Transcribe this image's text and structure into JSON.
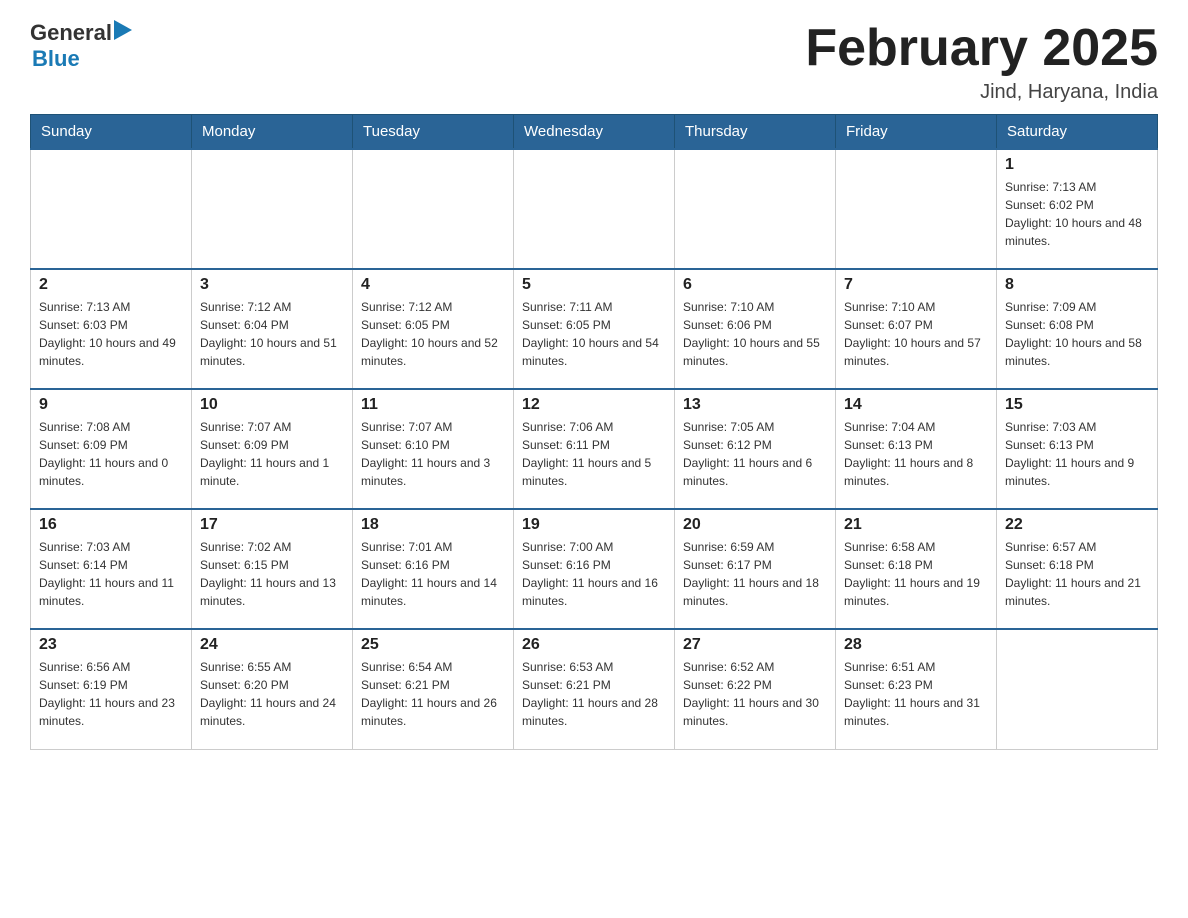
{
  "header": {
    "logo": {
      "general": "General",
      "arrow": "▶",
      "blue": "Blue"
    },
    "title": "February 2025",
    "location": "Jind, Haryana, India"
  },
  "days_of_week": [
    "Sunday",
    "Monday",
    "Tuesday",
    "Wednesday",
    "Thursday",
    "Friday",
    "Saturday"
  ],
  "weeks": [
    [
      {
        "day": "",
        "sunrise": "",
        "sunset": "",
        "daylight": ""
      },
      {
        "day": "",
        "sunrise": "",
        "sunset": "",
        "daylight": ""
      },
      {
        "day": "",
        "sunrise": "",
        "sunset": "",
        "daylight": ""
      },
      {
        "day": "",
        "sunrise": "",
        "sunset": "",
        "daylight": ""
      },
      {
        "day": "",
        "sunrise": "",
        "sunset": "",
        "daylight": ""
      },
      {
        "day": "",
        "sunrise": "",
        "sunset": "",
        "daylight": ""
      },
      {
        "day": "1",
        "sunrise": "Sunrise: 7:13 AM",
        "sunset": "Sunset: 6:02 PM",
        "daylight": "Daylight: 10 hours and 48 minutes."
      }
    ],
    [
      {
        "day": "2",
        "sunrise": "Sunrise: 7:13 AM",
        "sunset": "Sunset: 6:03 PM",
        "daylight": "Daylight: 10 hours and 49 minutes."
      },
      {
        "day": "3",
        "sunrise": "Sunrise: 7:12 AM",
        "sunset": "Sunset: 6:04 PM",
        "daylight": "Daylight: 10 hours and 51 minutes."
      },
      {
        "day": "4",
        "sunrise": "Sunrise: 7:12 AM",
        "sunset": "Sunset: 6:05 PM",
        "daylight": "Daylight: 10 hours and 52 minutes."
      },
      {
        "day": "5",
        "sunrise": "Sunrise: 7:11 AM",
        "sunset": "Sunset: 6:05 PM",
        "daylight": "Daylight: 10 hours and 54 minutes."
      },
      {
        "day": "6",
        "sunrise": "Sunrise: 7:10 AM",
        "sunset": "Sunset: 6:06 PM",
        "daylight": "Daylight: 10 hours and 55 minutes."
      },
      {
        "day": "7",
        "sunrise": "Sunrise: 7:10 AM",
        "sunset": "Sunset: 6:07 PM",
        "daylight": "Daylight: 10 hours and 57 minutes."
      },
      {
        "day": "8",
        "sunrise": "Sunrise: 7:09 AM",
        "sunset": "Sunset: 6:08 PM",
        "daylight": "Daylight: 10 hours and 58 minutes."
      }
    ],
    [
      {
        "day": "9",
        "sunrise": "Sunrise: 7:08 AM",
        "sunset": "Sunset: 6:09 PM",
        "daylight": "Daylight: 11 hours and 0 minutes."
      },
      {
        "day": "10",
        "sunrise": "Sunrise: 7:07 AM",
        "sunset": "Sunset: 6:09 PM",
        "daylight": "Daylight: 11 hours and 1 minute."
      },
      {
        "day": "11",
        "sunrise": "Sunrise: 7:07 AM",
        "sunset": "Sunset: 6:10 PM",
        "daylight": "Daylight: 11 hours and 3 minutes."
      },
      {
        "day": "12",
        "sunrise": "Sunrise: 7:06 AM",
        "sunset": "Sunset: 6:11 PM",
        "daylight": "Daylight: 11 hours and 5 minutes."
      },
      {
        "day": "13",
        "sunrise": "Sunrise: 7:05 AM",
        "sunset": "Sunset: 6:12 PM",
        "daylight": "Daylight: 11 hours and 6 minutes."
      },
      {
        "day": "14",
        "sunrise": "Sunrise: 7:04 AM",
        "sunset": "Sunset: 6:13 PM",
        "daylight": "Daylight: 11 hours and 8 minutes."
      },
      {
        "day": "15",
        "sunrise": "Sunrise: 7:03 AM",
        "sunset": "Sunset: 6:13 PM",
        "daylight": "Daylight: 11 hours and 9 minutes."
      }
    ],
    [
      {
        "day": "16",
        "sunrise": "Sunrise: 7:03 AM",
        "sunset": "Sunset: 6:14 PM",
        "daylight": "Daylight: 11 hours and 11 minutes."
      },
      {
        "day": "17",
        "sunrise": "Sunrise: 7:02 AM",
        "sunset": "Sunset: 6:15 PM",
        "daylight": "Daylight: 11 hours and 13 minutes."
      },
      {
        "day": "18",
        "sunrise": "Sunrise: 7:01 AM",
        "sunset": "Sunset: 6:16 PM",
        "daylight": "Daylight: 11 hours and 14 minutes."
      },
      {
        "day": "19",
        "sunrise": "Sunrise: 7:00 AM",
        "sunset": "Sunset: 6:16 PM",
        "daylight": "Daylight: 11 hours and 16 minutes."
      },
      {
        "day": "20",
        "sunrise": "Sunrise: 6:59 AM",
        "sunset": "Sunset: 6:17 PM",
        "daylight": "Daylight: 11 hours and 18 minutes."
      },
      {
        "day": "21",
        "sunrise": "Sunrise: 6:58 AM",
        "sunset": "Sunset: 6:18 PM",
        "daylight": "Daylight: 11 hours and 19 minutes."
      },
      {
        "day": "22",
        "sunrise": "Sunrise: 6:57 AM",
        "sunset": "Sunset: 6:18 PM",
        "daylight": "Daylight: 11 hours and 21 minutes."
      }
    ],
    [
      {
        "day": "23",
        "sunrise": "Sunrise: 6:56 AM",
        "sunset": "Sunset: 6:19 PM",
        "daylight": "Daylight: 11 hours and 23 minutes."
      },
      {
        "day": "24",
        "sunrise": "Sunrise: 6:55 AM",
        "sunset": "Sunset: 6:20 PM",
        "daylight": "Daylight: 11 hours and 24 minutes."
      },
      {
        "day": "25",
        "sunrise": "Sunrise: 6:54 AM",
        "sunset": "Sunset: 6:21 PM",
        "daylight": "Daylight: 11 hours and 26 minutes."
      },
      {
        "day": "26",
        "sunrise": "Sunrise: 6:53 AM",
        "sunset": "Sunset: 6:21 PM",
        "daylight": "Daylight: 11 hours and 28 minutes."
      },
      {
        "day": "27",
        "sunrise": "Sunrise: 6:52 AM",
        "sunset": "Sunset: 6:22 PM",
        "daylight": "Daylight: 11 hours and 30 minutes."
      },
      {
        "day": "28",
        "sunrise": "Sunrise: 6:51 AM",
        "sunset": "Sunset: 6:23 PM",
        "daylight": "Daylight: 11 hours and 31 minutes."
      },
      {
        "day": "",
        "sunrise": "",
        "sunset": "",
        "daylight": ""
      }
    ]
  ]
}
